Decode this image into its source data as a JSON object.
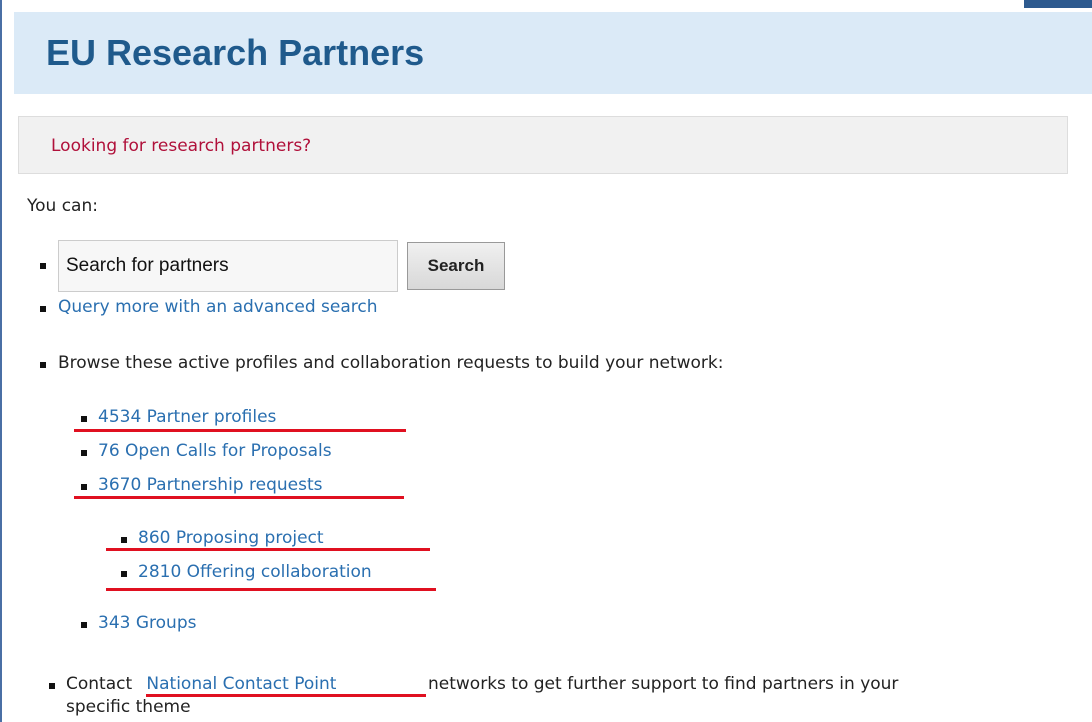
{
  "header": {
    "title": "EU Research Partners"
  },
  "banner": {
    "text": "Looking for research partners?"
  },
  "intro": {
    "text": "You can:"
  },
  "search": {
    "value": "Search for partners",
    "button_label": "Search",
    "advanced_link": "Query more with an advanced search"
  },
  "browse": {
    "text": "Browse these active profiles and collaboration requests to build your network:",
    "items": [
      {
        "label": "4534 Partner profiles"
      },
      {
        "label": "76 Open Calls for Proposals"
      },
      {
        "label": "3670 Partnership requests"
      }
    ],
    "sub_items": [
      {
        "label": "860 Proposing project"
      },
      {
        "label": "2810 Offering collaboration"
      }
    ],
    "groups_label": "343 Groups"
  },
  "contact": {
    "prefix": "Contact",
    "link": " National Contact Point ",
    "suffix": "networks to get further support to find partners in your",
    "line2": "specific theme"
  },
  "colors": {
    "header_bg": "#dbeaf7",
    "title": "#1f5a8c",
    "banner_text": "#b0103a",
    "link": "#2a6fb0",
    "highlight": "#e01020"
  }
}
